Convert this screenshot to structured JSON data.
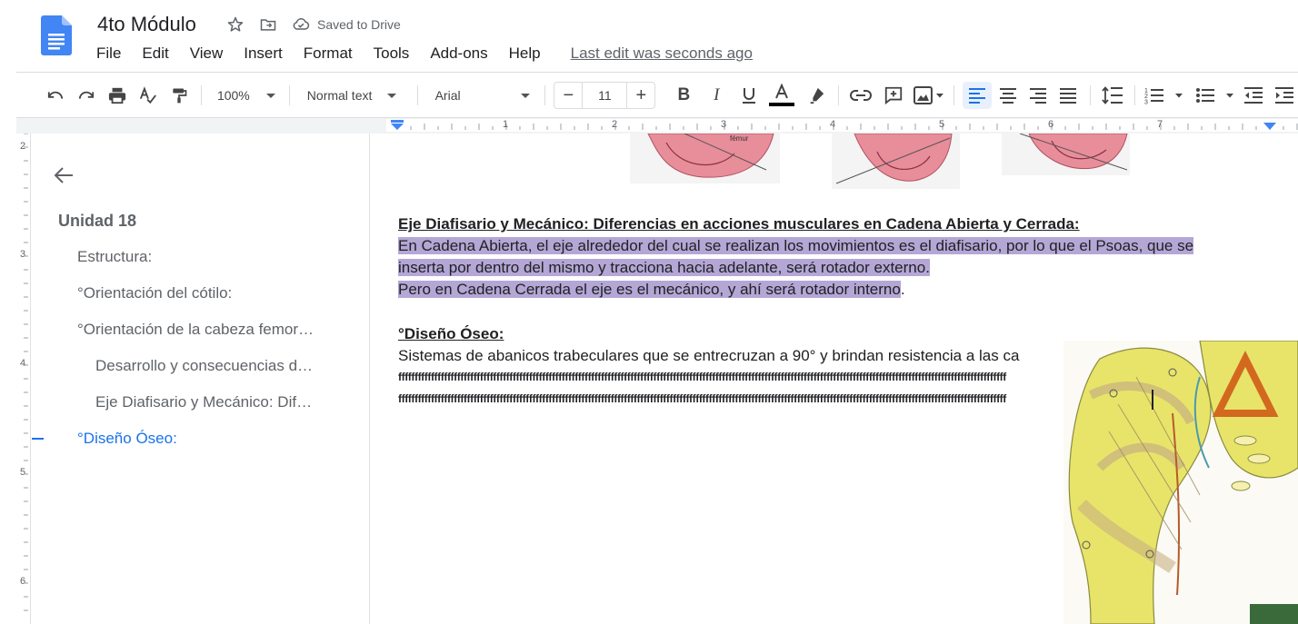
{
  "header": {
    "title": "4to Módulo",
    "saved_status": "Saved to Drive",
    "last_edit": "Last edit was seconds ago",
    "menu": [
      "File",
      "Edit",
      "View",
      "Insert",
      "Format",
      "Tools",
      "Add-ons",
      "Help"
    ]
  },
  "toolbar": {
    "zoom": "100%",
    "style": "Normal text",
    "font": "Arial",
    "font_size": "11",
    "text_color": "#000000",
    "active_align": "left"
  },
  "ruler": {
    "h_numbers": [
      "1",
      "2",
      "3",
      "4",
      "5",
      "6",
      "7"
    ],
    "v_numbers": [
      "2",
      "3",
      "4",
      "5",
      "6"
    ]
  },
  "outline": {
    "title": "Unidad 18",
    "items": [
      {
        "label": "Estructura:",
        "level": 1
      },
      {
        "label": "°Orientación del cótilo:",
        "level": 1
      },
      {
        "label": "°Orientación de la cabeza femor…",
        "level": 1
      },
      {
        "label": "Desarrollo y consecuencias d…",
        "level": 2
      },
      {
        "label": "Eje Diafisario y Mecánico: Dif…",
        "level": 2
      },
      {
        "label": "°Diseño Óseo:",
        "level": 1,
        "active": true
      }
    ]
  },
  "document": {
    "heading1": "Eje Diafisario y Mecánico: Diferencias en acciones musculares en Cadena Abierta y Cerrada:",
    "p1_line1": " En Cadena Abierta, el eje alrededor del cual se realizan los movimientos es el diafisario, por lo que el Psoas, que se",
    "p1_line2": "inserta por dentro del mismo y tracciona hacia adelante, será rotador externo.",
    "p2_highlight": " Pero en Cadena Cerrada el eje es el mecánico, y ahí será rotador interno",
    "p2_tail": ".",
    "heading2": "°Diseño Óseo:",
    "p3": "Sistemas de abanicos trabeculares que se entrecruzan a 90° y brindan resistencia a las ca",
    "ffff_line1": "ffffffffffffffffffffffffffffffffffffffffffffffffffffffffffffffffffffffffffffffffffffffffffffffffffffffffffffffffffffffffffffffffffffffffffffffffffffffffffffffffffffffffffffffffffffffffff",
    "ffff_line2": "ffffffffffffffffffffffffffffffffffffffffffffffffffffffffffffffffffffffffffffffffffffffffffffffffffffffffffffffffffffffffffffffffffffffffffffffffffffffffffffffffffffffffffffffffffffffffff",
    "fig_label": "fémur",
    "highlight_color": "#b4a7d6"
  }
}
